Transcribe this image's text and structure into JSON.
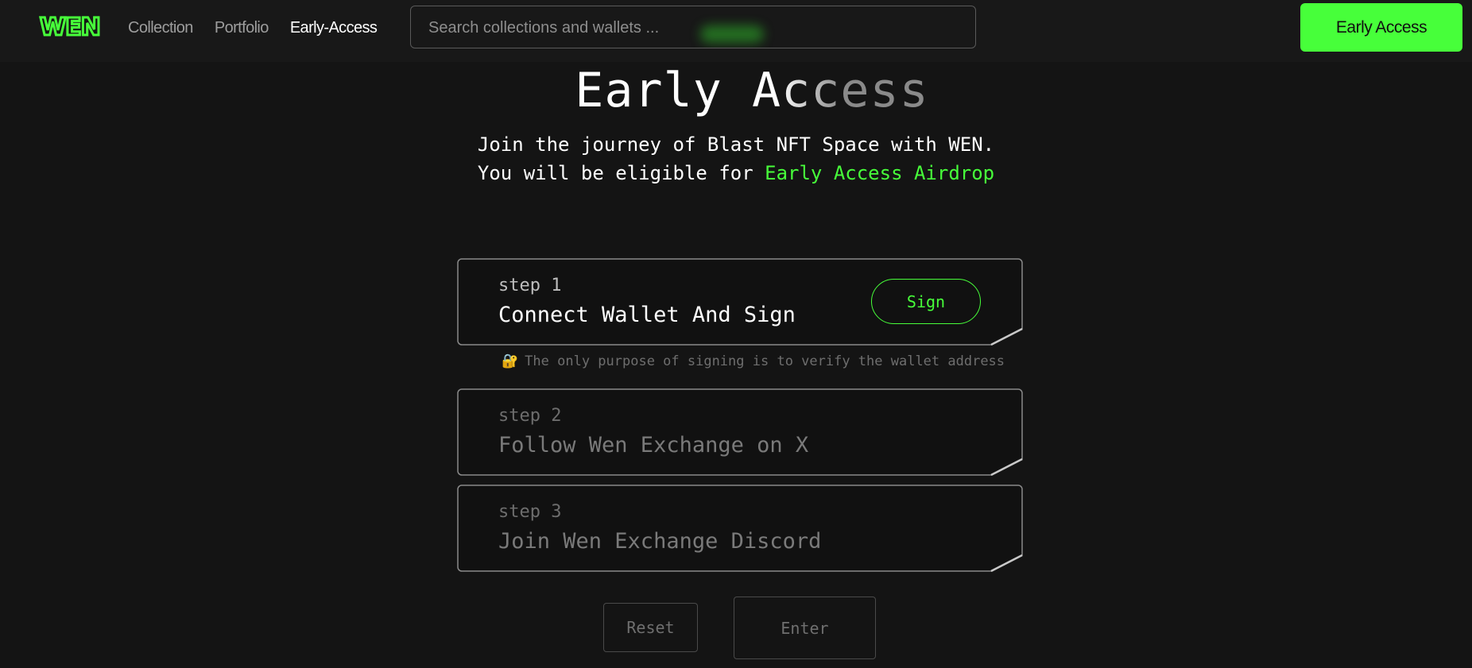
{
  "brand": {
    "logo_text": "WEN"
  },
  "nav": {
    "items": [
      {
        "label": "Collection"
      },
      {
        "label": "Portfolio"
      },
      {
        "label": "Early-Access"
      }
    ]
  },
  "search": {
    "placeholder": "Search collections and wallets ..."
  },
  "header_cta": {
    "label": "Early Access"
  },
  "hero": {
    "title": "Early Access",
    "line1": "Join the journey of Blast NFT Space with WEN.",
    "line2_prefix": "You will be eligible for ",
    "line2_highlight": "Early Access Airdrop"
  },
  "steps": [
    {
      "label": "step 1",
      "title": "Connect Wallet And Sign",
      "action": "Sign",
      "state": "active"
    },
    {
      "label": "step 2",
      "title": "Follow Wen Exchange on X",
      "state": "disabled"
    },
    {
      "label": "step 3",
      "title": "Join Wen Exchange Discord",
      "state": "disabled"
    }
  ],
  "note": {
    "icon": "lock-icon",
    "text": "The only purpose of signing is to verify the wallet address"
  },
  "actions": {
    "reset": "Reset",
    "enter": "Enter"
  },
  "colors": {
    "accent": "#47ff3a",
    "background": "#141414",
    "card": "#111111"
  }
}
